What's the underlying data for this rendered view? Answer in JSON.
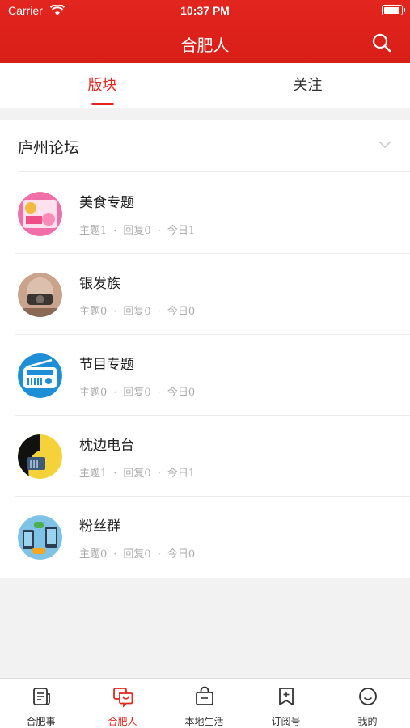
{
  "status_bar": {
    "carrier": "Carrier",
    "time": "10:37 PM"
  },
  "header": {
    "title": "合肥人",
    "icon": "search-icon"
  },
  "tabs": [
    {
      "label": "版块",
      "active": true
    },
    {
      "label": "关注",
      "active": false
    }
  ],
  "forum": {
    "title": "庐州论坛",
    "items": [
      {
        "name": "美食专题",
        "topics": "主题1",
        "replies": "回复0",
        "today": "今日1"
      },
      {
        "name": "银发族",
        "topics": "主题0",
        "replies": "回复0",
        "today": "今日0"
      },
      {
        "name": "节目专题",
        "topics": "主题0",
        "replies": "回复0",
        "today": "今日0"
      },
      {
        "name": "枕边电台",
        "topics": "主题1",
        "replies": "回复0",
        "today": "今日1"
      },
      {
        "name": "粉丝群",
        "topics": "主题0",
        "replies": "回复0",
        "today": "今日0"
      }
    ],
    "separator": "·"
  },
  "bottom_nav": [
    {
      "label": "合肥事",
      "icon": "news-icon",
      "active": false
    },
    {
      "label": "合肥人",
      "icon": "chat-icon",
      "active": true
    },
    {
      "label": "本地生活",
      "icon": "bag-icon",
      "active": false
    },
    {
      "label": "订阅号",
      "icon": "bookmark-add-icon",
      "active": false
    },
    {
      "label": "我的",
      "icon": "smile-icon",
      "active": false
    }
  ],
  "colors": {
    "brand_red": "#e2261f",
    "text_muted": "#aaaaaa"
  }
}
